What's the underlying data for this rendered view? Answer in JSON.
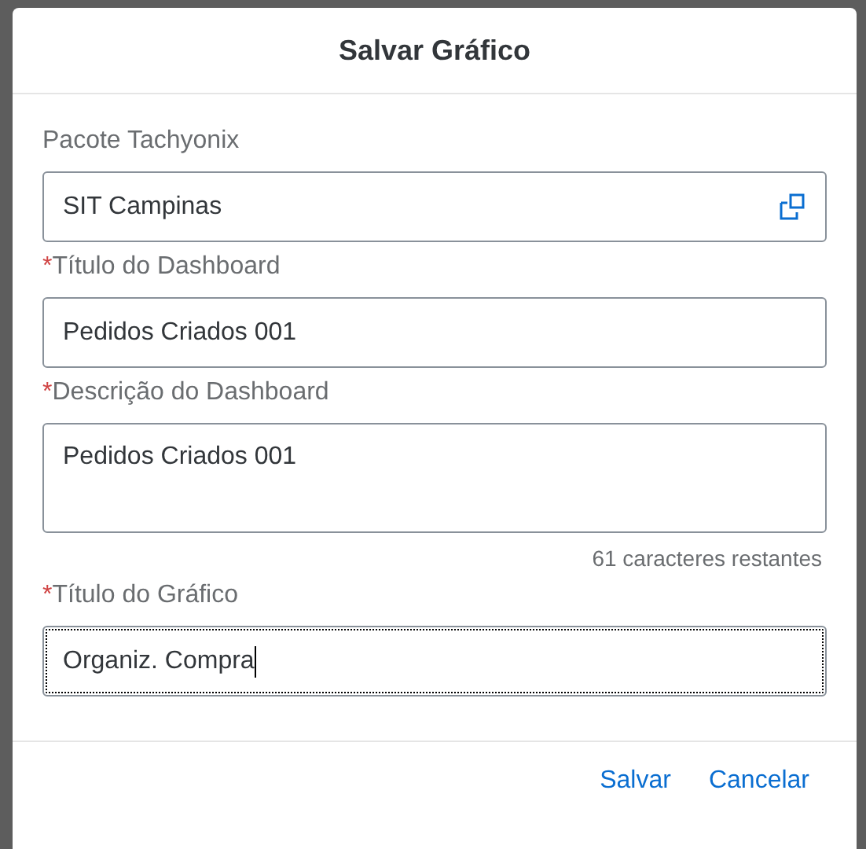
{
  "dialog": {
    "title": "Salvar Gráfico",
    "fields": [
      {
        "kind": "value-help",
        "label": "Pacote Tachyonix",
        "value": "SIT Campinas",
        "focused": false
      },
      {
        "kind": "input",
        "required_mark": "*",
        "label": "Título do Dashboard",
        "value": "Pedidos Criados 001",
        "focused": false
      },
      {
        "kind": "textarea",
        "required_mark": "*",
        "label": "Descrição do Dashboard",
        "value": "Pedidos Criados 001",
        "focused": false,
        "counter": "61 caracteres restantes"
      },
      {
        "kind": "input",
        "required_mark": "*",
        "label": "Título do Gráfico",
        "value": "Organiz. Compra",
        "focused": true
      }
    ],
    "buttons": [
      "Salvar",
      "Cancelar"
    ]
  }
}
